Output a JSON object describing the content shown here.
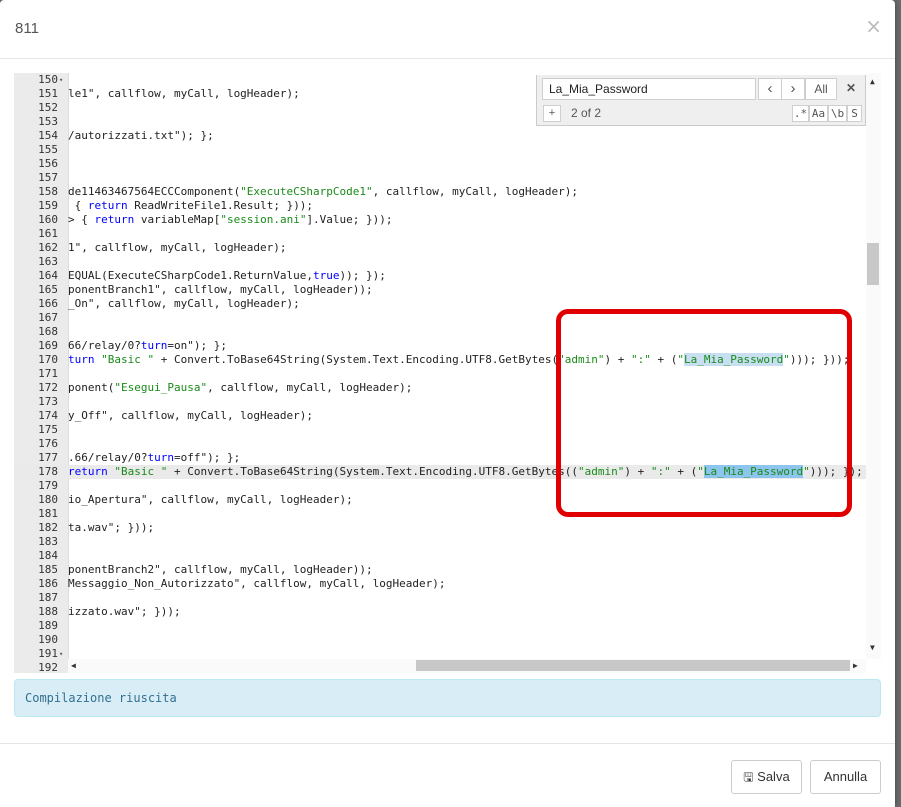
{
  "modal": {
    "title": "811",
    "close": "×"
  },
  "search": {
    "query": "La_Mia_Password",
    "prev": "‹",
    "next": "›",
    "all_label": "All",
    "close": "✕",
    "add": "+",
    "counter": "2 of 2",
    "regex": ".*",
    "case": "Aa",
    "word": "\\b",
    "selection": "S"
  },
  "editor": {
    "lines": [
      {
        "n": "150",
        "fold": true,
        "code": ""
      },
      {
        "n": "151",
        "code": "le1\", callflow, myCall, logHeader);"
      },
      {
        "n": "152",
        "code": ""
      },
      {
        "n": "153",
        "code": ""
      },
      {
        "n": "154",
        "code": "/autorizzati.txt\"); };"
      },
      {
        "n": "155",
        "code": ""
      },
      {
        "n": "156",
        "code": ""
      },
      {
        "n": "157",
        "code": ""
      },
      {
        "n": "158",
        "code": "de11463467564ECCComponent(\"ExecuteCSharpCode1\", callflow, myCall, logHeader);"
      },
      {
        "n": "159",
        "code": " { return ReadWriteFile1.Result; }));"
      },
      {
        "n": "160",
        "code": "> { return variableMap[\"session.ani\"].Value; }));"
      },
      {
        "n": "161",
        "code": ""
      },
      {
        "n": "162",
        "code": "1\", callflow, myCall, logHeader);"
      },
      {
        "n": "163",
        "code": ""
      },
      {
        "n": "164",
        "code": "EQUAL(ExecuteCSharpCode1.ReturnValue,true)); });"
      },
      {
        "n": "165",
        "code": "ponentBranch1\", callflow, myCall, logHeader));"
      },
      {
        "n": "166",
        "code": "_On\", callflow, myCall, logHeader);"
      },
      {
        "n": "167",
        "code": ""
      },
      {
        "n": "168",
        "code": ""
      },
      {
        "n": "169",
        "code": "66/relay/0?turn=on\"); };"
      },
      {
        "n": "170",
        "code": "turn \"Basic \" + Convert.ToBase64String(System.Text.Encoding.UTF8.GetBytes(\"admin\") + \":\" + (\"La_Mia_Password\"))); }));"
      },
      {
        "n": "171",
        "code": ""
      },
      {
        "n": "172",
        "code": "ponent(\"Esegui_Pausa\", callflow, myCall, logHeader);"
      },
      {
        "n": "173",
        "code": ""
      },
      {
        "n": "174",
        "code": "y_Off\", callflow, myCall, logHeader);"
      },
      {
        "n": "175",
        "code": ""
      },
      {
        "n": "176",
        "code": ""
      },
      {
        "n": "177",
        "code": ".66/relay/0?turn=off\"); };"
      },
      {
        "n": "178",
        "code": "return \"Basic \" + Convert.ToBase64String(System.Text.Encoding.UTF8.GetBytes((\"admin\") + \":\" + (\"La_Mia_Password\"))); });"
      },
      {
        "n": "179",
        "code": ""
      },
      {
        "n": "180",
        "code": "io_Apertura\", callflow, myCall, logHeader);"
      },
      {
        "n": "181",
        "code": ""
      },
      {
        "n": "182",
        "code": "ta.wav\"; }));"
      },
      {
        "n": "183",
        "code": ""
      },
      {
        "n": "184",
        "code": ""
      },
      {
        "n": "185",
        "code": "ponentBranch2\", callflow, myCall, logHeader));"
      },
      {
        "n": "186",
        "code": "Messaggio_Non_Autorizzato\", callflow, myCall, logHeader);"
      },
      {
        "n": "187",
        "code": ""
      },
      {
        "n": "188",
        "code": "izzato.wav\"; }));"
      },
      {
        "n": "189",
        "code": ""
      },
      {
        "n": "190",
        "code": ""
      },
      {
        "n": "191",
        "fold": true,
        "code": ""
      },
      {
        "n": "192",
        "code": ""
      }
    ]
  },
  "status": {
    "message": "Compilazione riuscita"
  },
  "footer": {
    "save_label": "Salva",
    "cancel_label": "Annulla"
  },
  "colors": {
    "accent_red": "#e00000",
    "string_green": "#1a8a1a",
    "keyword_blue": "#0000ff",
    "alert_bg": "#d9edf7"
  }
}
